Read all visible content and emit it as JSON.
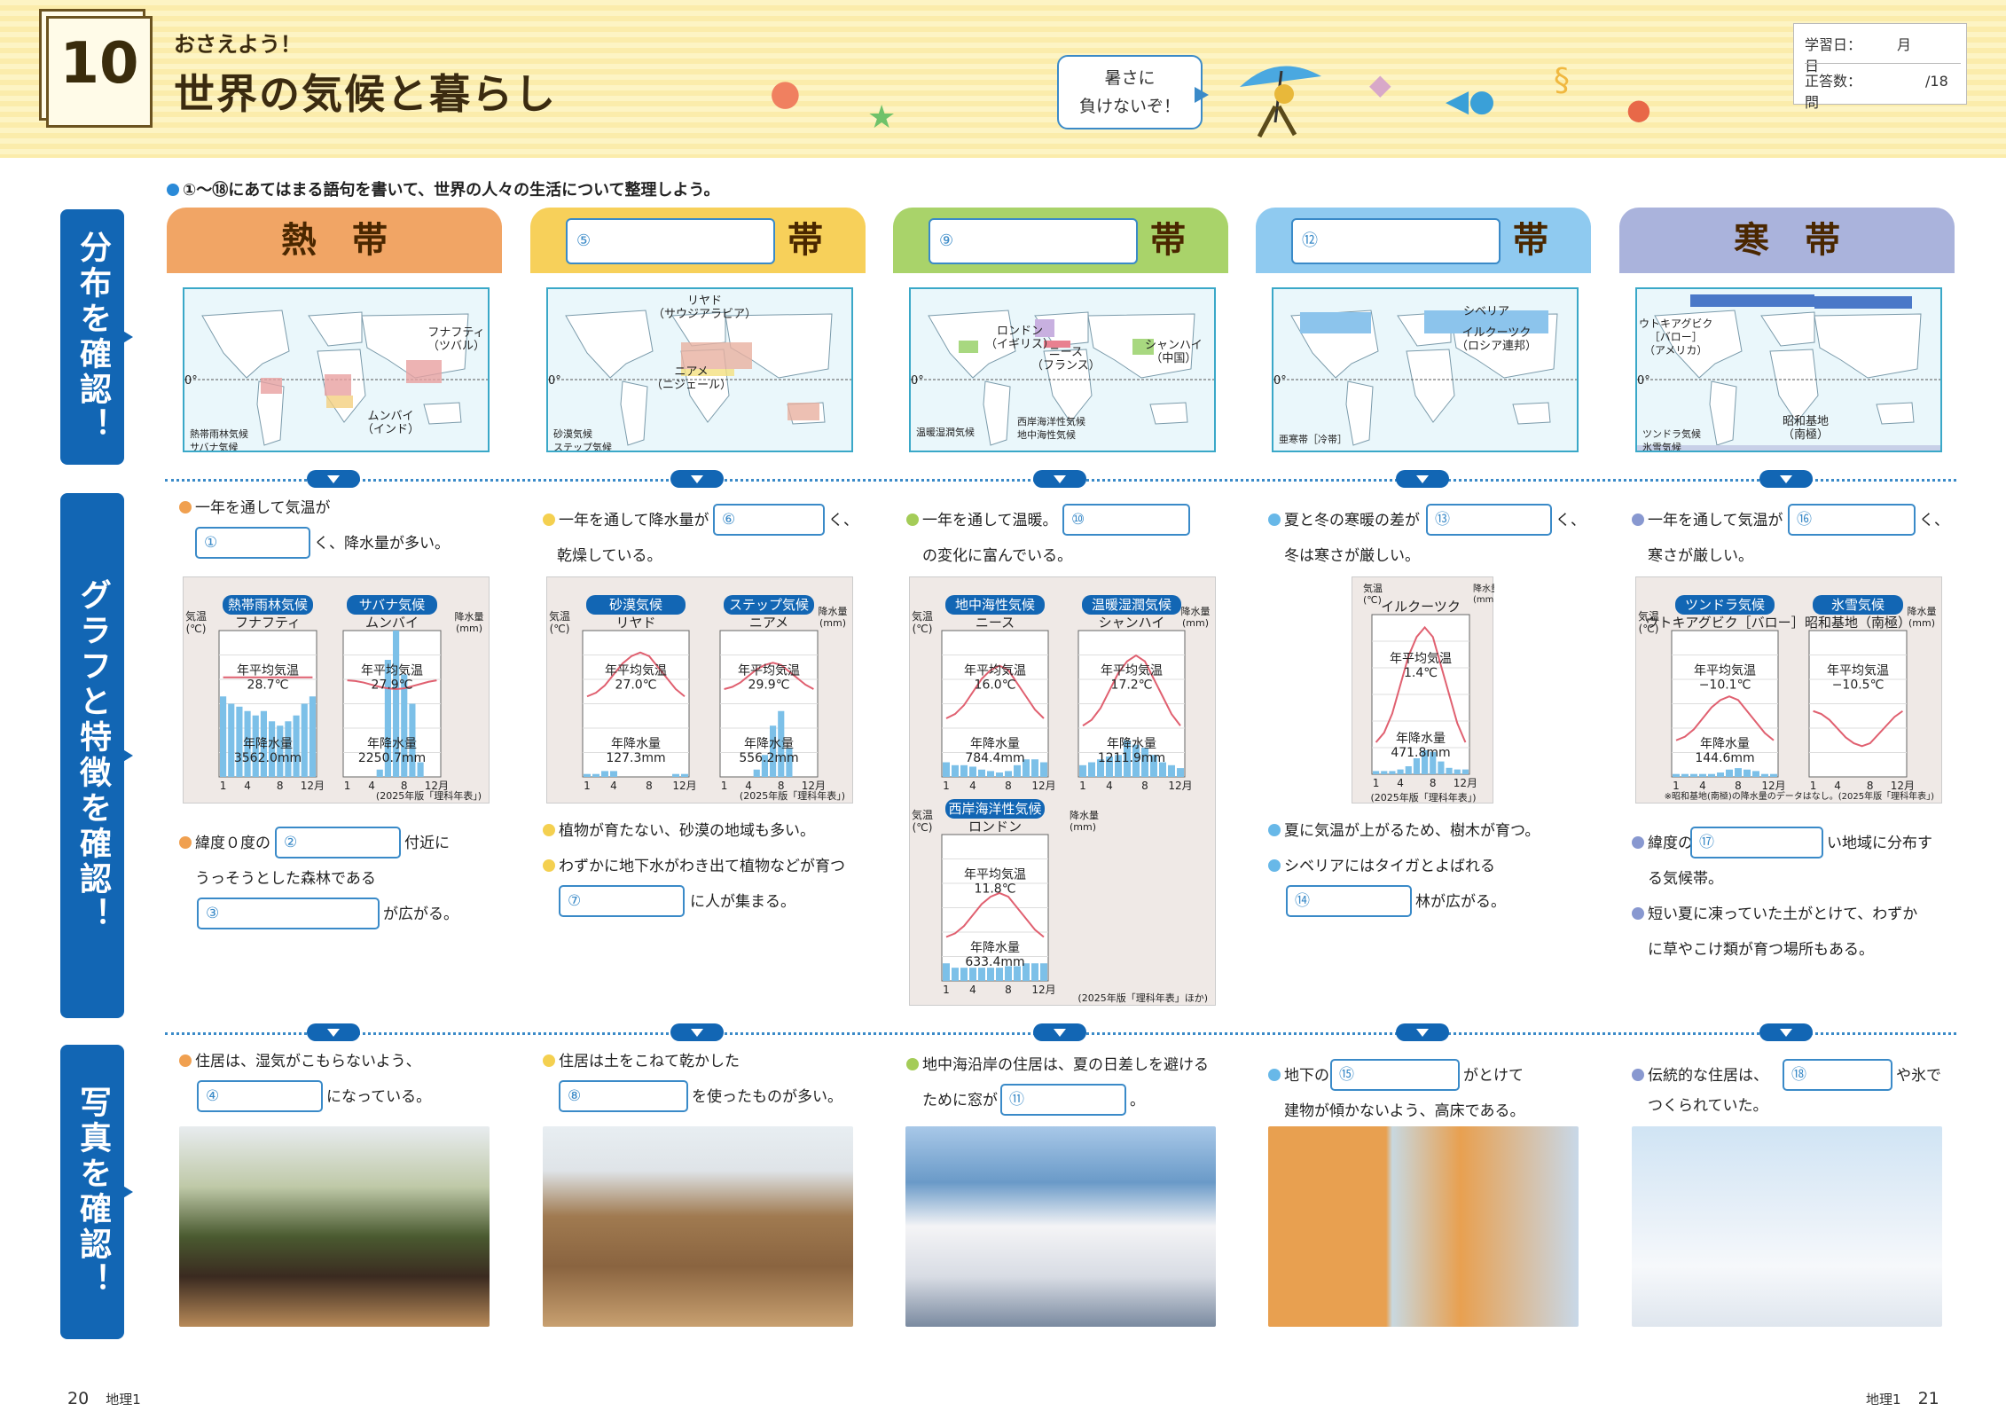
{
  "header": {
    "unit": "10",
    "subtitle": "おさえよう！",
    "title": "世界の気候と暮らし",
    "bubble_line1": "暑さに",
    "bubble_line2": "負けないぞ！",
    "study_date": "学習日：　　　月　　　日",
    "study_score": "正答数：　　　　　/18問"
  },
  "instruction": "①〜⑱にあてはまる語句を書いて、世界の人々の生活について整理しよう。",
  "sidebar": {
    "distribution": "分布を確認！",
    "graph": "グラフと特徴を確認！",
    "photo": "写真を確認！"
  },
  "zones": [
    {
      "name": "熱　帯",
      "color": "#f1a565",
      "input": "",
      "suffix": ""
    },
    {
      "name": "",
      "color": "#f7d05a",
      "input": "⑤",
      "suffix": "帯"
    },
    {
      "name": "",
      "color": "#a9d36a",
      "input": "⑨",
      "suffix": "帯"
    },
    {
      "name": "",
      "color": "#8fcaf0",
      "input": "⑫",
      "suffix": "帯"
    },
    {
      "name": "寒　帯",
      "color": "#aab3dc",
      "input": "",
      "suffix": ""
    }
  ],
  "maps": [
    {
      "labels": [
        "フナフティ\n（ツバル）",
        "ムンバイ\n（インド）"
      ],
      "legend": [
        "熱帯雨林気候",
        "サバナ気候"
      ]
    },
    {
      "labels": [
        "リヤド\n（サウジアラビア）",
        "ニアメ\n（ニジェール）"
      ],
      "legend": [
        "砂漠気候",
        "ステップ気候"
      ]
    },
    {
      "labels": [
        "ロンドン\n（イギリス）",
        "ニース\n（フランス）",
        "シャンハイ\n（中国）"
      ],
      "legend": [
        "温暖湿潤気候",
        "西岸海洋性気候",
        "地中海性気候"
      ]
    },
    {
      "labels": [
        "シベリア",
        "イルクーツク\n（ロシア連邦）"
      ],
      "legend": [
        "亜寒帯［冷帯］"
      ]
    },
    {
      "labels": [
        "ウトキアグビク\n［バロー］\n（アメリカ）",
        "昭和基地\n（南極）"
      ],
      "legend": [
        "ツンドラ気候",
        "氷雪気候"
      ]
    }
  ],
  "map_zero": "0°",
  "text": {
    "c1a": "一年を通して気温が",
    "c1b": "く、降水量が多い。",
    "a1": "①",
    "c1c": "緯度０度の",
    "a2": "②",
    "c1d": "付近に",
    "c1e": "うっそうとした森林である",
    "a3": "③",
    "c1f": "が広がる。",
    "c2a": "一年を通して降水量が",
    "a6": "⑥",
    "c2b": "く、",
    "c2c": "乾燥している。",
    "c2d": "植物が育たない、砂漠の地域も多い。",
    "c2e": "わずかに地下水がわき出て植物などが育つ",
    "a7": "⑦",
    "c2f": "に人が集まる。",
    "c3a": "一年を通して温暖。",
    "a10": "⑩",
    "c3b": "の変化に富んでいる。",
    "c4a": "夏と冬の寒暖の差が",
    "a13": "⑬",
    "c4b": "く、",
    "c4c": "冬は寒さが厳しい。",
    "c4d": "夏に気温が上がるため、樹木が育つ。",
    "c4e": "シベリアにはタイガとよばれる",
    "a14": "⑭",
    "c4f": "林が広がる。",
    "c5a": "一年を通して気温が",
    "a16": "⑯",
    "c5b": "く、",
    "c5c": "寒さが厳しい。",
    "c5d": "緯度の",
    "a17": "⑰",
    "c5e": "い地域に分布す",
    "c5f": "る気候帯。",
    "c5g": "短い夏に凍っていた土がとけて、わずか",
    "c5h": "に草やこけ類が育つ場所もある。",
    "p1a": "住居は、湿気がこもらないよう、",
    "a4": "④",
    "p1b": "になっている。",
    "p2a": "住居は土をこねて乾かした",
    "a8": "⑧",
    "p2b": "を使ったものが多い。",
    "p3a": "地中海沿岸の住居は、夏の日差しを避ける",
    "p3b": "ために窓が",
    "a11": "⑪",
    "p3c": "。",
    "p4a": "地下の",
    "a15": "⑮",
    "p4b": "がとけて",
    "p4c": "建物が傾かないよう、高床である。",
    "p5a": "伝統的な住居は、",
    "a18": "⑱",
    "p5b": "や氷で",
    "p5c": "つくられていた。"
  },
  "charts": [
    {
      "title1": "熱帯雨林気候",
      "title2": "サバナ気候",
      "city1": "フナフティ",
      "city2": "ムンバイ",
      "t1": "年平均気温\n28.7℃",
      "p1": "年降水量\n3562.0mm",
      "t2": "年平均気温\n27.9℃",
      "p2": "年降水量\n2250.7mm",
      "src": "(2025年版「理科年表」)"
    },
    {
      "title1": "砂漠気候",
      "title2": "ステップ気候",
      "city1": "リヤド",
      "city2": "ニアメ",
      "t1": "年平均気温\n27.0℃",
      "p1": "年降水量\n127.3mm",
      "t2": "年平均気温\n29.9℃",
      "p2": "年降水量\n556.2mm",
      "src": "(2025年版「理科年表」)"
    },
    {
      "title1": "地中海性気候",
      "title2": "温暖湿潤気候",
      "city1": "ニース",
      "city2": "シャンハイ",
      "t1": "年平均気温\n16.0℃",
      "p1": "年降水量\n784.4mm",
      "t2": "年平均気温\n17.2℃",
      "p2": "年降水量\n1211.9mm",
      "title3": "西岸海洋性気候",
      "city3": "ロンドン",
      "t3": "年平均気温\n11.8℃",
      "p3": "年降水量\n633.4mm",
      "src": "(2025年版「理科年表」ほか)"
    },
    {
      "title1": "",
      "city1": "イルクーツク",
      "t1": "年平均気温\n1.4℃",
      "p1": "年降水量\n471.8mm",
      "src": "(2025年版「理科年表」)"
    },
    {
      "title1": "ツンドラ気候",
      "title2": "氷雪気候",
      "city1": "ウトキアグビク［バロー］",
      "city2": "昭和基地（南極）",
      "t1": "年平均気温\n−10.1℃",
      "p1": "年降水量\n144.6mm",
      "t2": "年平均気温\n−10.5℃",
      "src": "※昭和基地(南極)の降水量のデータはなし。(2025年版「理科年表」)"
    }
  ],
  "axis": {
    "temp": "気温\n(℃)",
    "precip": "降水量\n(mm)",
    "months": [
      "1",
      "4",
      "8",
      "12月"
    ]
  },
  "footer": {
    "left": "20",
    "left_label": "地理1",
    "right": "21",
    "right_label": "地理1"
  }
}
